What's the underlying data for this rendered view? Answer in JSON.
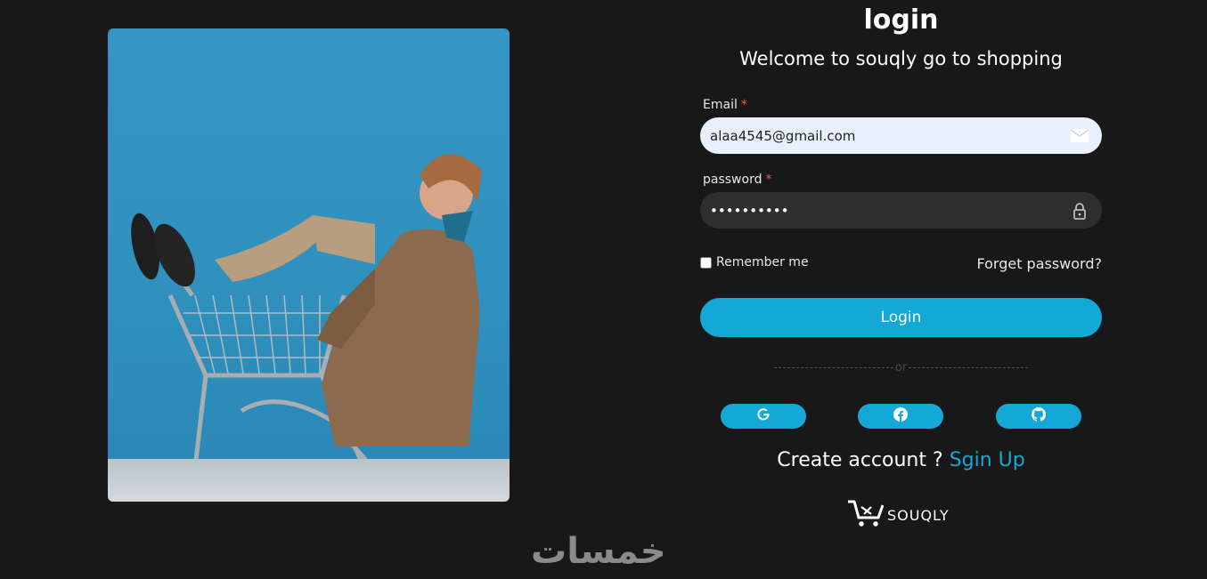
{
  "header": {
    "title": "login",
    "subtitle": "Welcome to souqly go to shopping"
  },
  "form": {
    "email_label": "Email",
    "email_value": "alaa4545@gmail.com",
    "password_label": "password",
    "password_value": "**********",
    "required_mark": "*",
    "remember_label": "Remember me",
    "forget_label": "Forget password?",
    "login_label": "Login",
    "divider_text": "or"
  },
  "social": {
    "google_icon": "google-icon",
    "facebook_icon": "facebook-icon",
    "github_icon": "github-icon"
  },
  "footer": {
    "create_text": "Create account ?",
    "signup_link": "Sgin Up",
    "brand_name": "SOUQLY",
    "watermark": "خمسات"
  },
  "colors": {
    "background": "#181818",
    "accent": "#14a8d6",
    "email_field": "#e8f0fe",
    "password_field": "#2e2e2e"
  }
}
